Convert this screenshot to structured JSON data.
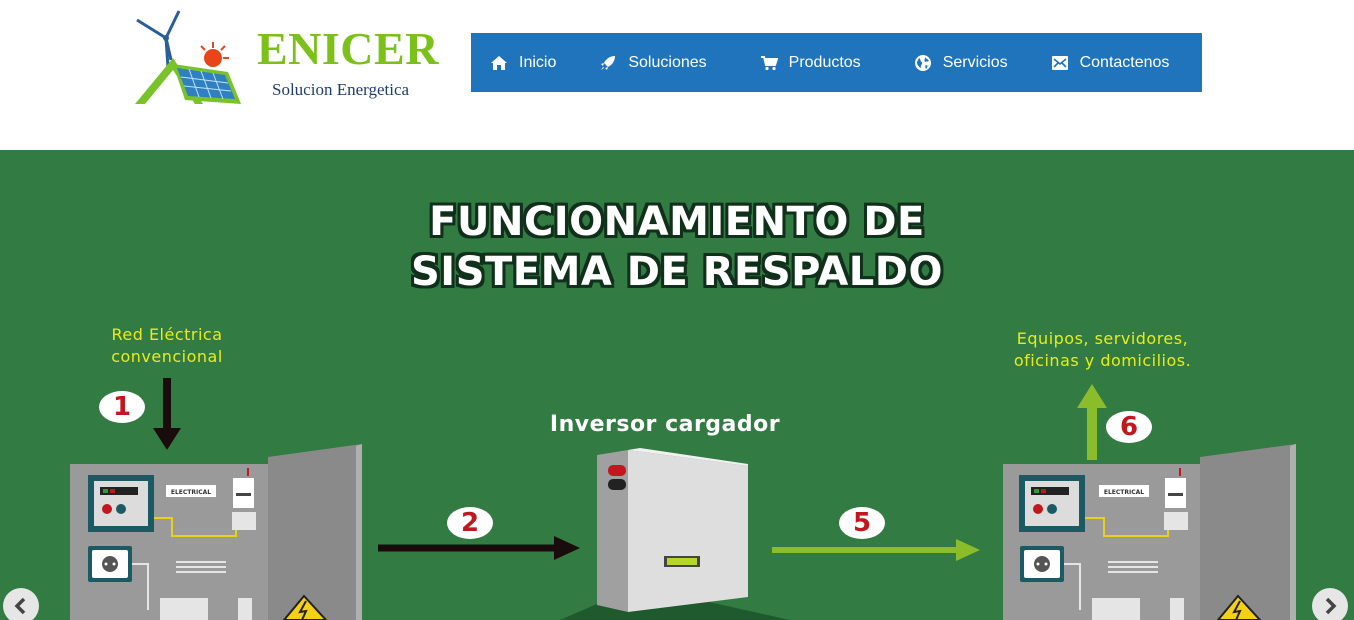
{
  "header": {
    "brand": "ENICER",
    "tagline": "Solucion Energetica",
    "logo_icon": "wind-solar-house-logo"
  },
  "nav": {
    "items": [
      {
        "label": "Inicio",
        "icon": "home-icon"
      },
      {
        "label": "Soluciones",
        "icon": "rocket-icon"
      },
      {
        "label": "Productos",
        "icon": "cart-icon"
      },
      {
        "label": "Servicios",
        "icon": "globe-icon"
      },
      {
        "label": "Contactenos",
        "icon": "envelope-icon"
      }
    ],
    "background": "#1f74bb"
  },
  "banner": {
    "title_line1": "FUNCIONAMIENTO DE",
    "title_line2": "SISTEMA DE RESPALDO",
    "grid_label_line1": "Red Eléctrica",
    "grid_label_line2": "convencional",
    "devices_label_line1": "Equipos, servidores,",
    "devices_label_line2": "oficinas y domicilios.",
    "inverter_label": "Inversor cargador",
    "panel_tag": "ELECTRICAL",
    "steps": [
      "1",
      "2",
      "5",
      "6"
    ],
    "background": "#327b42"
  },
  "carousel": {
    "prev_icon": "chevron-left-icon",
    "next_icon": "chevron-right-icon"
  }
}
